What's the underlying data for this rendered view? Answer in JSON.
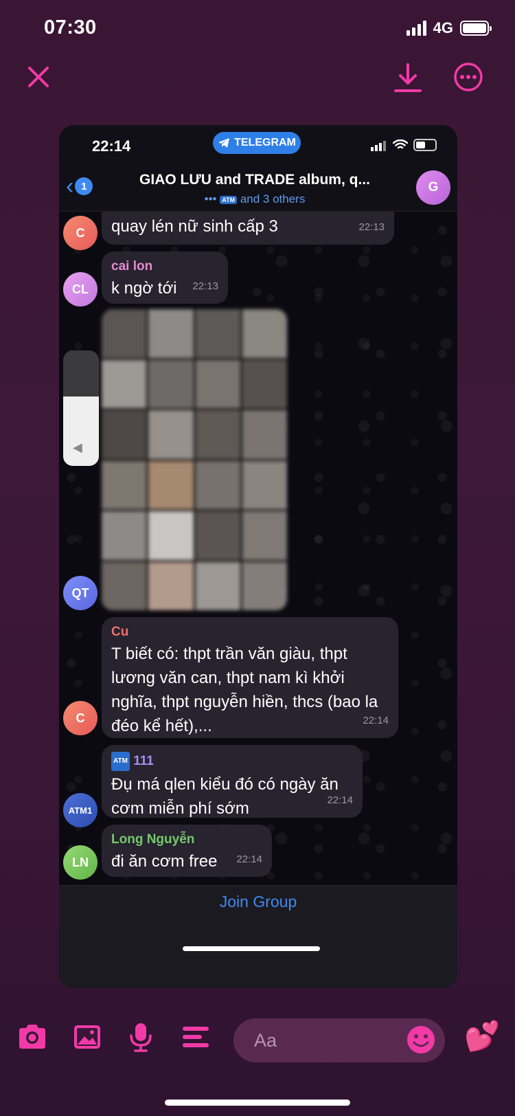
{
  "status": {
    "time": "07:30",
    "network": "4G"
  },
  "topbar": {
    "close": "close",
    "download": "download",
    "more": "more"
  },
  "telegram": {
    "status_time": "22:14",
    "app_pill": "TELEGRAM",
    "back_badge": "1",
    "title": "GIAO LƯU and TRADE album, q...",
    "subtitle_prefix": "•••",
    "subtitle_atm": "ATM",
    "subtitle": "and 3 others",
    "group_avatar": "G"
  },
  "messages": [
    {
      "avatar": "C",
      "avatar_color": "#f0705f",
      "name": "",
      "text": "quay lén nữ sinh cấp 3",
      "time": "22:13"
    },
    {
      "avatar": "CL",
      "avatar_color": "#d986e8",
      "name": "cai lon",
      "name_color": "#e78ad3",
      "text": "k ngờ tới",
      "time": "22:13"
    },
    {
      "avatar": "QT",
      "avatar_color": "#6a7df0",
      "media": true
    },
    {
      "avatar": "C",
      "avatar_color": "#f0705f",
      "name": "Cu",
      "name_color": "#f06f6f",
      "text": "T biết có: thpt trần văn giàu, thpt lương văn can, thpt nam kì khởi nghĩa, thpt nguyễn hiền, thcs (bao la đéo kể hết),...",
      "time": "22:14"
    },
    {
      "avatar": "ATM1",
      "avatar_color": "#3a63c4",
      "name": "111",
      "name_atm": "ATM",
      "name_color": "#a58ff5",
      "text": "Đụ má qlen kiểu đó có ngày ăn cơm miễn phí sớm",
      "time": "22:14"
    },
    {
      "avatar": "LN",
      "avatar_color": "#7bc75f",
      "name": "Long Nguyễn",
      "name_color": "#76c96a",
      "text": "đi ăn cơm free",
      "time": "22:14"
    }
  ],
  "volume_level": 0.6,
  "join_group": "Join Group",
  "composer": {
    "placeholder": "Aa"
  },
  "colors": {
    "accent": "#f23aa7",
    "telegram_blue": "#3e8af0"
  }
}
